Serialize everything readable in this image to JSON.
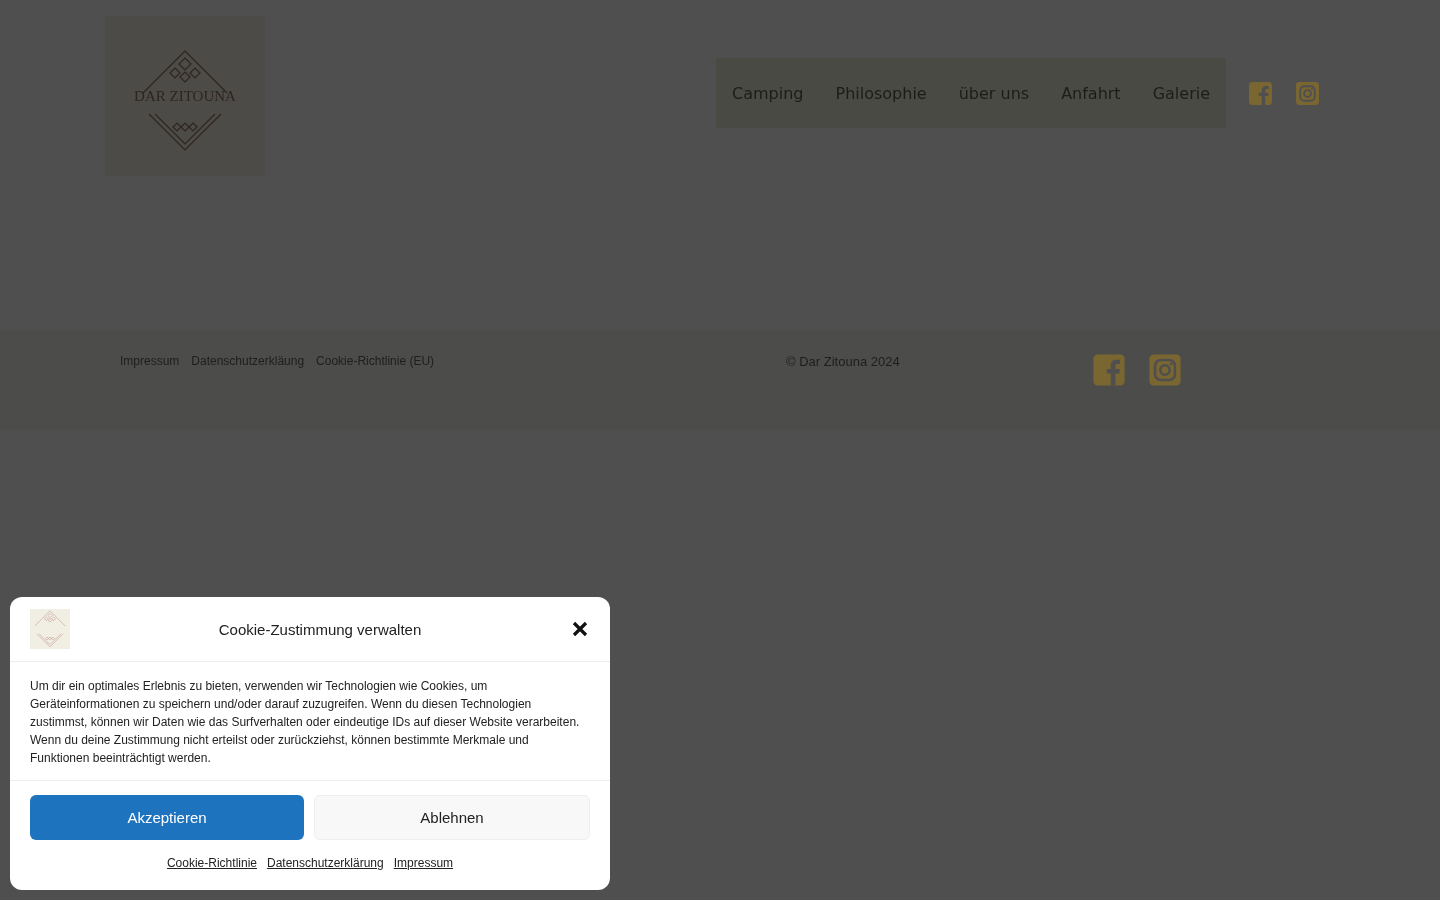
{
  "header": {
    "logo_text": "DAR ZITOUNA",
    "nav": [
      "Camping",
      "Philosophie",
      "über uns",
      "Anfahrt",
      "Galerie"
    ],
    "social": [
      {
        "kind": "facebook"
      },
      {
        "kind": "instagram"
      }
    ]
  },
  "footer": {
    "links": [
      "Impressum",
      "Datenschutzerkläung",
      "Cookie-Richtlinie (EU)"
    ],
    "copyright": "© Dar Zitouna 2024",
    "social": [
      {
        "kind": "facebook"
      },
      {
        "kind": "instagram"
      }
    ]
  },
  "cookie_dialog": {
    "title": "Cookie-Zustimmung verwalten",
    "text": "Um dir ein optimales Erlebnis zu bieten, verwenden wir Technologien wie Cookies, um Geräteinformationen zu speichern und/oder darauf zuzugreifen. Wenn du diesen Technologien zustimmst, können wir Daten wie das Surfverhalten oder eindeutige IDs auf dieser Website verarbeiten. Wenn du deine Zustimmung nicht erteilst oder zurückziehst, können bestimmte Merkmale und Funktionen beeinträchtigt werden.",
    "buttons": [
      {
        "label": "Akzeptieren",
        "kind": "primary"
      },
      {
        "label": "Ablehnen",
        "kind": "secondary"
      }
    ],
    "links": [
      "Cookie-Richtlinie",
      "Datenschutzerklärung",
      "Impressum"
    ]
  }
}
